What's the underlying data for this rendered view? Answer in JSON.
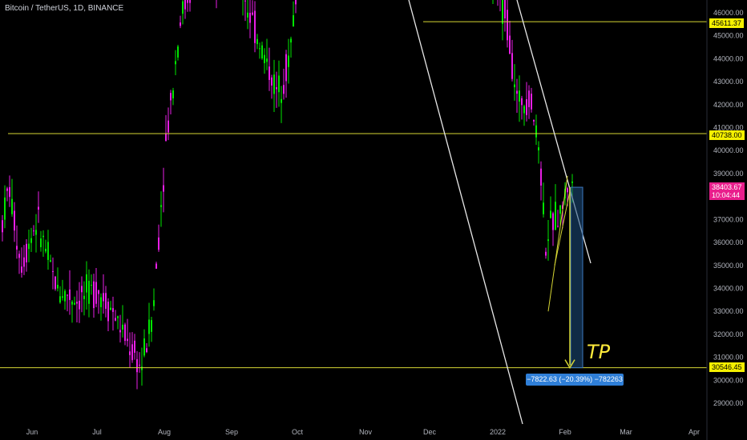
{
  "title": "Bitcoin / TetherUS, 1D, BINANCE",
  "tp_label": "TP",
  "measure_label": "−7822.63 (−20.39%) −782263",
  "current_price": "38403.67",
  "countdown": "10:04:44",
  "level_badges": [
    "45611.37",
    "40738.00",
    "30546.45"
  ],
  "colors": {
    "up": "#00e600",
    "down": "#e91ee6",
    "level": "#d6d634",
    "trendline": "#e8e8e8",
    "badge": "#f5f000",
    "current": "#e91e8c"
  },
  "chart_data": {
    "type": "candlestick",
    "symbol": "Bitcoin / TetherUS",
    "interval": "1D",
    "exchange": "BINANCE",
    "y_ticks": [
      29000,
      30000,
      31000,
      32000,
      33000,
      34000,
      35000,
      36000,
      37000,
      38000,
      39000,
      40000,
      41000,
      42000,
      43000,
      44000,
      45000,
      46000
    ],
    "x_ticks": [
      "Jun",
      "Jul",
      "Aug",
      "Sep",
      "Oct",
      "Nov",
      "Dec",
      "2022",
      "Feb",
      "Mar",
      "Apr"
    ],
    "horizontal_levels": [
      45611.37,
      40738.0,
      30546.45
    ],
    "current_price": 38403.67,
    "target": {
      "label": "TP",
      "from": 38403.67,
      "to": 30546.45,
      "change": -7822.63,
      "change_pct": -20.39
    },
    "candles_approx": [
      {
        "month": "Jun",
        "high": 41000,
        "low": 31000
      },
      {
        "month": "Jul",
        "high": 36000,
        "low": 29000
      },
      {
        "month": "Aug",
        "high": 50000,
        "low": 37000
      },
      {
        "month": "Sep",
        "high": 52000,
        "low": 40000
      },
      {
        "month": "Oct",
        "high": 67000,
        "low": 43000
      },
      {
        "month": "Dec",
        "high": 59000,
        "low": 42000
      },
      {
        "month": "Jan",
        "high": 47000,
        "low": 33000
      },
      {
        "month": "Feb",
        "high": 39000,
        "low": 36500
      }
    ]
  }
}
